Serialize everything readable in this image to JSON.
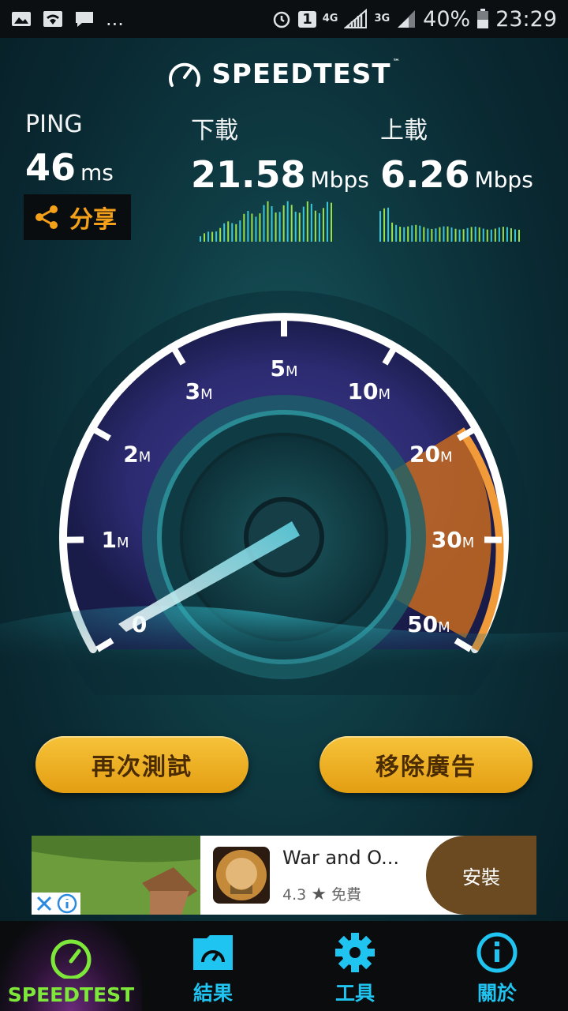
{
  "status_bar": {
    "notif_more": "...",
    "sim_badge": "1",
    "net1": "4G",
    "net2": "3G",
    "battery": "40%",
    "time": "23:29"
  },
  "header": {
    "logo": "SPEEDTEST",
    "tm": "™"
  },
  "ping": {
    "label": "PING",
    "value": "46",
    "unit": "ms"
  },
  "download": {
    "label": "下載",
    "value": "21.58",
    "unit": "Mbps"
  },
  "upload": {
    "label": "上載",
    "value": "6.26",
    "unit": "Mbps"
  },
  "share": {
    "label": "分享"
  },
  "gauge": {
    "ticks": [
      {
        "num": "0",
        "m": ""
      },
      {
        "num": "1",
        "m": "M"
      },
      {
        "num": "2",
        "m": "M"
      },
      {
        "num": "3",
        "m": "M"
      },
      {
        "num": "5",
        "m": "M"
      },
      {
        "num": "10",
        "m": "M"
      },
      {
        "num": "20",
        "m": "M"
      },
      {
        "num": "30",
        "m": "M"
      },
      {
        "num": "50",
        "m": "M"
      }
    ]
  },
  "buttons": {
    "retest": "再次測試",
    "remove_ads": "移除廣告"
  },
  "ad": {
    "title": "War and O...",
    "rating": "4.3",
    "price": "免費",
    "install": "安裝"
  },
  "nav": [
    {
      "label": "SPEEDTEST",
      "icon": "speedometer-icon"
    },
    {
      "label": "結果",
      "icon": "folder-gauge-icon"
    },
    {
      "label": "工具",
      "icon": "gear-icon"
    },
    {
      "label": "關於",
      "icon": "info-icon"
    }
  ],
  "colors": {
    "accent_green": "#7ee83a",
    "accent_blue": "#20c4f0",
    "button": "#f0b024",
    "share_orange": "#f4a019"
  }
}
